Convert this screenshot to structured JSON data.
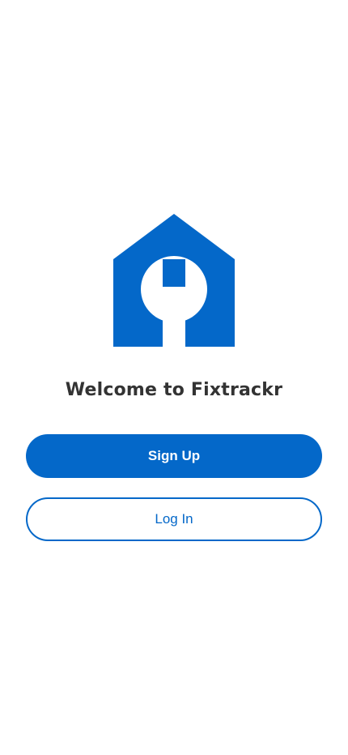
{
  "welcome": {
    "title": "Welcome to Fixtrackr"
  },
  "logo": {
    "icon": "house-wrench-icon",
    "color": "#0468c9"
  },
  "actions": {
    "sign_up_label": "Sign Up",
    "log_in_label": "Log In"
  },
  "colors": {
    "accent": "#0468c9",
    "title_text": "#333333",
    "background": "#ffffff"
  }
}
